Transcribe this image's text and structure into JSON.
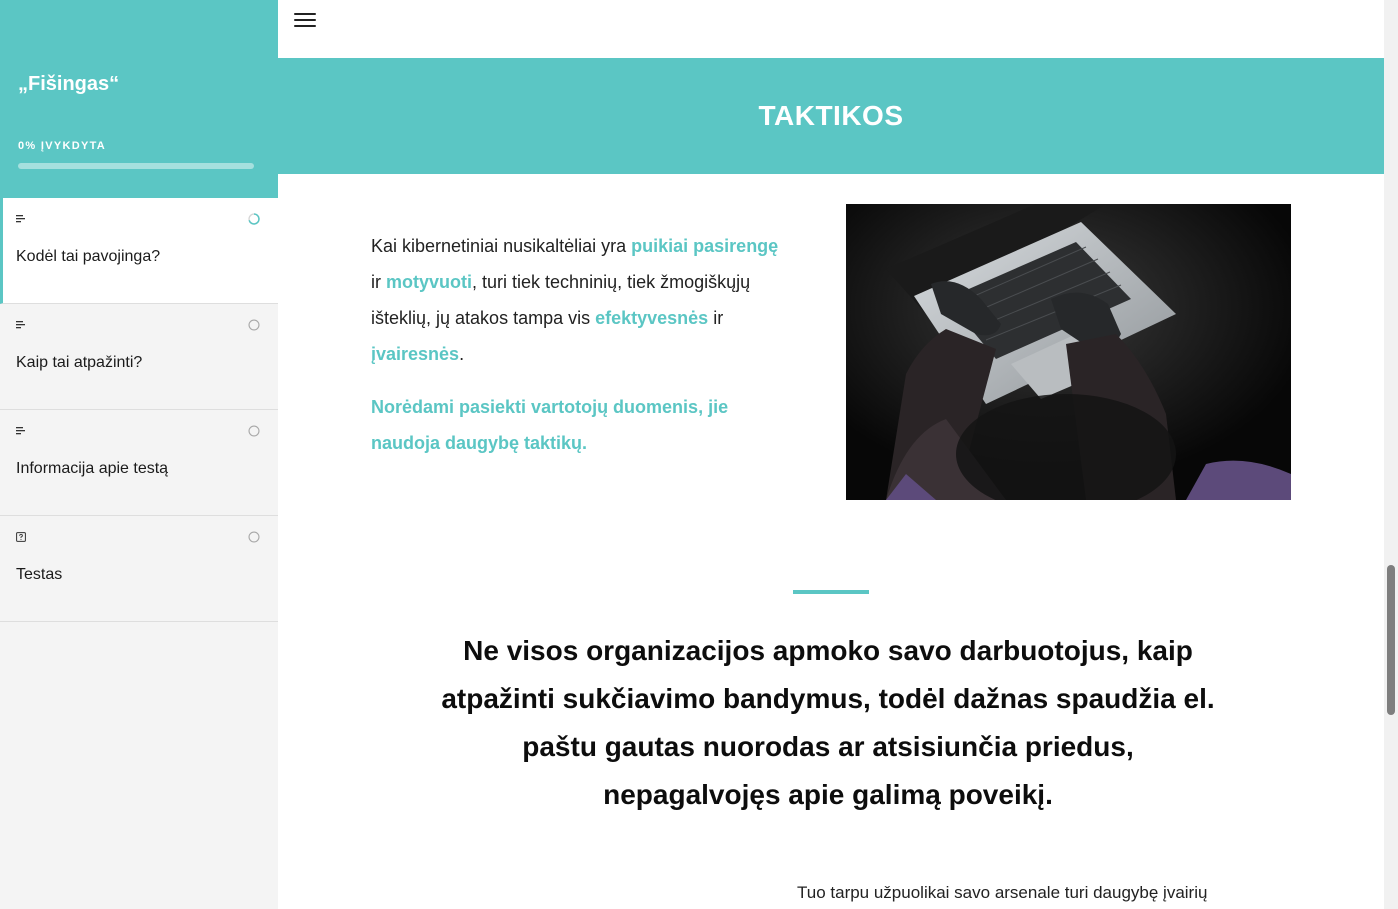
{
  "sidebar": {
    "course_title": "„Fišingas“",
    "progress_label": "0% ĮVYKDYTA",
    "progress_value": 0,
    "items": [
      {
        "label": "Kodėl tai pavojinga?",
        "type_icon": "text-lines-icon",
        "status": "in-progress",
        "active": true
      },
      {
        "label": "Kaip tai atpažinti?",
        "type_icon": "text-lines-icon",
        "status": "not-started",
        "active": false
      },
      {
        "label": "Informacija apie testą",
        "type_icon": "text-lines-icon",
        "status": "not-started",
        "active": false
      },
      {
        "label": "Testas",
        "type_icon": "quiz-icon",
        "status": "not-started",
        "active": false
      }
    ]
  },
  "header": {
    "menu_icon": "hamburger-icon"
  },
  "banner": {
    "title": "TAKTIKOS"
  },
  "intro": {
    "p1_a": "Kai kibernetiniai nusikaltėliai yra ",
    "p1_hl1": "puikiai pasirengę",
    "p1_b": " ir ",
    "p1_hl2": "motyvuoti",
    "p1_c": ", turi tiek techninių, tiek žmogiškųjų išteklių, jų atakos tampa vis ",
    "p1_hl3": "efektyvesnės",
    "p1_d": " ir ",
    "p1_hl4": "įvairesnės",
    "p1_e": ".",
    "p2": "Norėdami pasiekti vartotojų duomenis, jie naudoja daugybę taktikų."
  },
  "quote": "Ne visos organizacijos apmoko savo darbuotojus, kaip atpažinti sukčiavimo bandymus, todėl dažnas spaudžia el. paštu gautas nuorodas ar atsisiunčia priedus, nepagalvojęs apie galimą poveikį.",
  "bottom_text": "Tuo tarpu užpuolikai savo arsenale turi daugybę įvairių",
  "colors": {
    "accent": "#5bc6c4",
    "text": "#111111",
    "sidebar_bg": "#f4f4f4"
  }
}
